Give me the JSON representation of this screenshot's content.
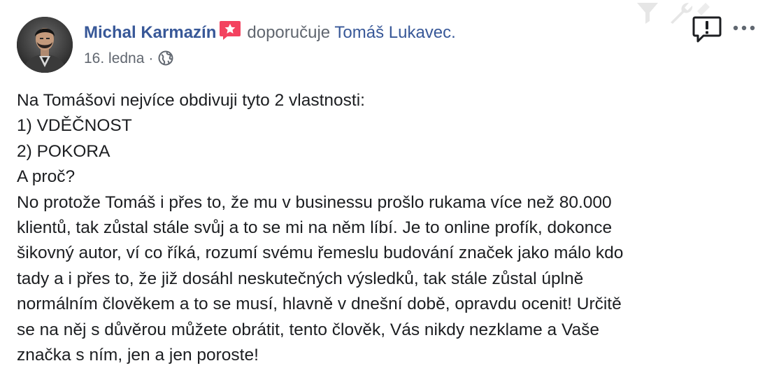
{
  "post": {
    "author": "Michal Karmazín",
    "verb": "doporučuje",
    "target": "Tomáš Lukavec.",
    "date": "16. ledna",
    "separator": "·",
    "icons": {
      "badge": "recommendation-star-icon",
      "privacy": "globe-icon",
      "report": "report-icon",
      "more": "more-options-icon",
      "faint": [
        "filter-icon",
        "wrench-icon"
      ]
    },
    "colors": {
      "link": "#385898",
      "meta": "#616770",
      "badge": "#f3425f",
      "text": "#1c1e21"
    },
    "lines": [
      "Na Tomášovi nejvíce obdivuji tyto 2 vlastnosti:",
      "1) VDĚČNOST",
      "2) POKORA",
      "A proč?",
      "No protože Tomáš i přes to, že mu v businessu prošlo rukama více než 80.000",
      "klientů, tak zůstal stále svůj a to se mi na něm líbí. Je to online profík, dokonce",
      "šikovný autor, ví co říká, rozumí svému řemeslu budování značek jako málo kdo",
      "tady a i přes to, že již dosáhl neskutečných výsledků, tak stále zůstal úplně",
      "normálním člověkem a to se musí, hlavně v dnešní době, opravdu ocenit! Určitě",
      "se na něj s důvěrou můžete obrátit, tento člověk, Vás nikdy nezklame a Vaše",
      "značka s ním, jen a jen poroste!"
    ]
  }
}
